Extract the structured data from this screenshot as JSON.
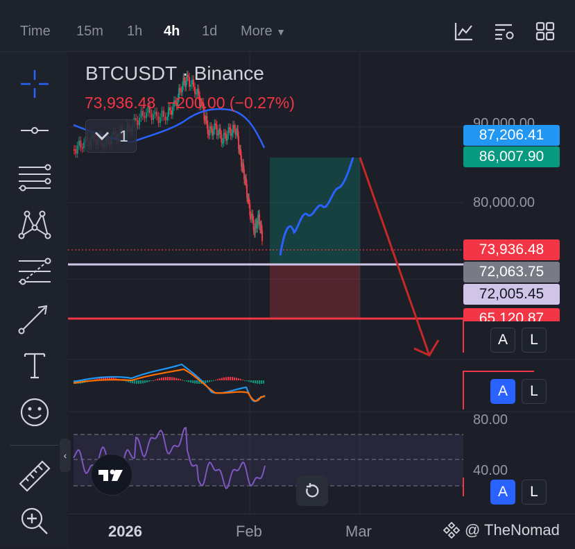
{
  "toolbar": {
    "timeframes": [
      {
        "label": "Time",
        "active": false
      },
      {
        "label": "15m",
        "active": false
      },
      {
        "label": "1h",
        "active": false
      },
      {
        "label": "4h",
        "active": true
      },
      {
        "label": "1d",
        "active": false
      },
      {
        "label": "More",
        "active": false
      }
    ],
    "icons": [
      "chart-type-icon",
      "indicators-icon",
      "layout-grid-icon"
    ]
  },
  "sidebar": {
    "tools": [
      "crosshair-icon",
      "horizontal-line-icon",
      "parallel-channel-icon",
      "pattern-icon",
      "fib-retracement-icon",
      "arrow-icon",
      "text-icon",
      "emoji-icon",
      "ruler-icon",
      "zoom-in-icon"
    ]
  },
  "legend": {
    "symbol": "BTCUSDT · Binance",
    "price": "73,936.48",
    "change": "−200.00 (−0.27%)",
    "hidden_count": "1"
  },
  "price_axis": {
    "tags": [
      {
        "label": "87,206.41",
        "bg": "#2196f3",
        "fg": "#ffffff"
      },
      {
        "label": "86,007.90",
        "bg": "#089981",
        "fg": "#ffffff"
      },
      {
        "label": "73,936.48",
        "bg": "#f23645",
        "fg": "#ffffff"
      },
      {
        "label": "72,063.75",
        "bg": "#787b86",
        "fg": "#ffffff"
      },
      {
        "label": "72,005.45",
        "bg": "#d1c4e9",
        "fg": "#131722"
      },
      {
        "label": "65,120.87",
        "bg": "#f23645",
        "fg": "#ffffff"
      }
    ],
    "labels": [
      "90,000.00",
      "80,000.00"
    ],
    "rsi_labels": [
      "80.00",
      "40.00"
    ]
  },
  "time_axis": {
    "labels": [
      "2026",
      "Feb",
      "Mar"
    ]
  },
  "alert_buttons": {
    "a": "A",
    "l": "L"
  },
  "watermark": "@ TheNomad",
  "colors": {
    "accent": "#2962ff",
    "up": "#089981",
    "down": "#f23645",
    "rsi": "#7e57c2"
  }
}
